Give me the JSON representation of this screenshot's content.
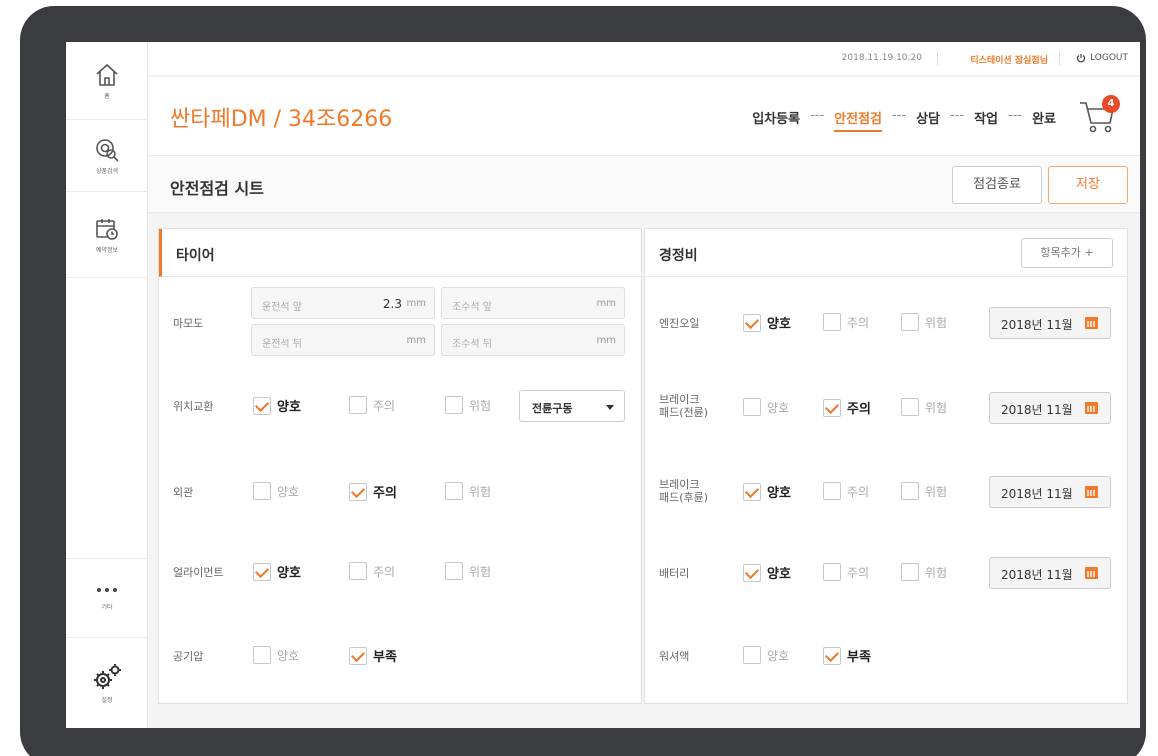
{
  "topbar": {
    "datetime": "2018.11.19 10:20",
    "user": "티스테이션 잠실점님",
    "logout": "LOGOUT"
  },
  "sidebar": {
    "items": [
      {
        "label": "홈",
        "icon": "home-icon"
      },
      {
        "label": "상품검색",
        "icon": "tire-search-icon"
      },
      {
        "label": "예약정보",
        "icon": "calendar-clock-icon"
      },
      {
        "label": "기타",
        "icon": "more-icon"
      },
      {
        "label": "설정",
        "icon": "gear-icon"
      }
    ]
  },
  "header": {
    "vehicle": "싼타페DM / 34조6266",
    "steps": [
      "입차등록",
      "안전점검",
      "상담",
      "작업",
      "완료"
    ],
    "step_separator": "---",
    "active_step": "안전점검",
    "cart_count": "4"
  },
  "sheet": {
    "title": "안전점검 시트",
    "end_button": "점검종료",
    "save_button": "저장"
  },
  "tire_panel": {
    "title": "타이어",
    "wear": {
      "label": "마모도",
      "fields": [
        {
          "placeholder": "운전석 앞",
          "value": "2.3",
          "unit": "mm"
        },
        {
          "placeholder": "조수석 앞",
          "value": "",
          "unit": "mm"
        },
        {
          "placeholder": "운전석 뒤",
          "value": "",
          "unit": "mm"
        },
        {
          "placeholder": "조수석 뒤",
          "value": "",
          "unit": "mm"
        }
      ]
    },
    "rows": [
      {
        "label": "위치교환",
        "options": [
          "양호",
          "주의",
          "위험"
        ],
        "checked": "양호",
        "select": "전륜구동"
      },
      {
        "label": "외관",
        "options": [
          "양호",
          "주의",
          "위험"
        ],
        "checked": "주의"
      },
      {
        "label": "얼라이먼트",
        "options": [
          "양호",
          "주의",
          "위험"
        ],
        "checked": "양호"
      },
      {
        "label": "공기압",
        "options": [
          "양호",
          "부족"
        ],
        "checked": "부족"
      }
    ]
  },
  "maint_panel": {
    "title": "경정비",
    "add_button": "항목추가 +",
    "rows": [
      {
        "label": "엔진오일",
        "options": [
          "양호",
          "주의",
          "위험"
        ],
        "checked": "양호",
        "date": "2018년 11월"
      },
      {
        "label": "브레이크\n패드(전륜)",
        "options": [
          "양호",
          "주의",
          "위험"
        ],
        "checked": "주의",
        "date": "2018년 11월"
      },
      {
        "label": "브레이크\n패드(후륜)",
        "options": [
          "양호",
          "주의",
          "위험"
        ],
        "checked": "양호",
        "date": "2018년 11월"
      },
      {
        "label": "배터리",
        "options": [
          "양호",
          "주의",
          "위험"
        ],
        "checked": "양호",
        "date": "2018년 11월"
      },
      {
        "label": "워셔액",
        "options": [
          "양호",
          "부족"
        ],
        "checked": "부족"
      }
    ]
  },
  "colors": {
    "accent": "#f07a2a",
    "badge": "#e94a2a",
    "device_frame": "#3a3c40"
  }
}
